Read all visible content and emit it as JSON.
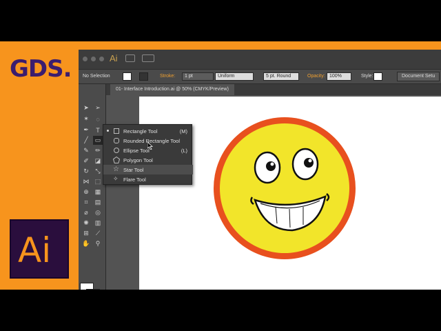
{
  "branding": {
    "logo_text": "GDS.",
    "ai_badge_text": "Ai",
    "orange": "#f7941d",
    "purple": "#3b1d6e"
  },
  "app": {
    "app_label": "Ai"
  },
  "control_bar": {
    "selection_label": "No Selection",
    "stroke_label": "Stroke:",
    "stroke_value": "1 pt",
    "profile_value": "Uniform",
    "brush_value": "5 pt. Round",
    "opacity_label": "Opacity:",
    "opacity_value": "100%",
    "style_label": "Style:",
    "doc_setup_label": "Document Setu"
  },
  "document": {
    "tab_title": "01- Interface Introduction.ai @ 50% (CMYK/Preview)"
  },
  "tool_flyout": {
    "items": [
      {
        "label": "Rectangle Tool",
        "shortcut": "(M)",
        "icon": "rectangle-icon",
        "selected": true
      },
      {
        "label": "Rounded Rectangle Tool",
        "shortcut": "",
        "icon": "rounded-rectangle-icon",
        "selected": false
      },
      {
        "label": "Ellipse Tool",
        "shortcut": "(L)",
        "icon": "ellipse-icon",
        "selected": false
      },
      {
        "label": "Polygon Tool",
        "shortcut": "",
        "icon": "polygon-icon",
        "selected": false
      },
      {
        "label": "Star Tool",
        "shortcut": "",
        "icon": "star-icon",
        "selected": false
      },
      {
        "label": "Flare Tool",
        "shortcut": "",
        "icon": "flare-icon",
        "selected": false
      }
    ]
  },
  "artwork": {
    "face_fill": "#f2e52a",
    "ring_color": "#e8501e"
  }
}
